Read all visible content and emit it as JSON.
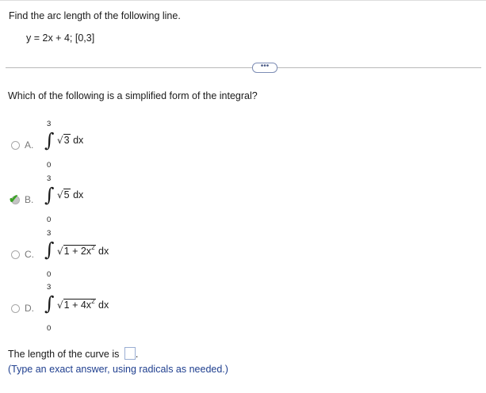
{
  "question": "Find the arc length of the following line.",
  "equation": "y = 2x + 4; [0,3]",
  "more_button": "•••",
  "subquestion": "Which of the following is a simplified form of the integral?",
  "options": [
    {
      "letter": "A.",
      "upper": "3",
      "lower": "0",
      "radicand": "3",
      "tail": " dx",
      "selected": false
    },
    {
      "letter": "B.",
      "upper": "3",
      "lower": "0",
      "radicand": "5",
      "tail": " dx",
      "selected": true
    },
    {
      "letter": "C.",
      "upper": "3",
      "lower": "0",
      "radicand": "1 + 2x",
      "exponent": "2",
      "tail": " dx",
      "selected": false
    },
    {
      "letter": "D.",
      "upper": "3",
      "lower": "0",
      "radicand": "1 + 4x",
      "exponent": "2",
      "tail": " dx",
      "selected": false
    }
  ],
  "answer_prompt": "The length of the curve is",
  "answer_value": "",
  "answer_suffix": ".",
  "hint": "(Type an exact answer, using radicals as needed.)",
  "colors": {
    "check": "#3aa324",
    "hint": "#1f3f8f",
    "divider": "#b8b8b8"
  },
  "icons": {
    "selected": "check-icon",
    "integral": "integral-sign-icon"
  }
}
